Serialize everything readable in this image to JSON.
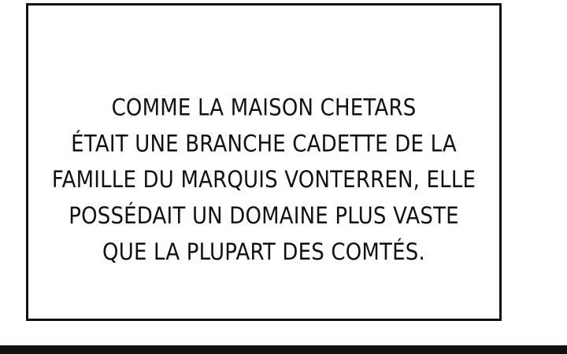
{
  "caption": {
    "lines": [
      "COMME LA MAISON CHETARS",
      "ÉTAIT UNE BRANCHE CADETTE DE LA",
      "FAMILLE DU MARQUIS VONTERREN, ELLE",
      "POSSÉDAIT UN DOMAINE PLUS VASTE",
      "QUE LA PLUPART DES COMTÉS."
    ]
  },
  "colors": {
    "background": "#ffffff",
    "ink": "#111111"
  }
}
